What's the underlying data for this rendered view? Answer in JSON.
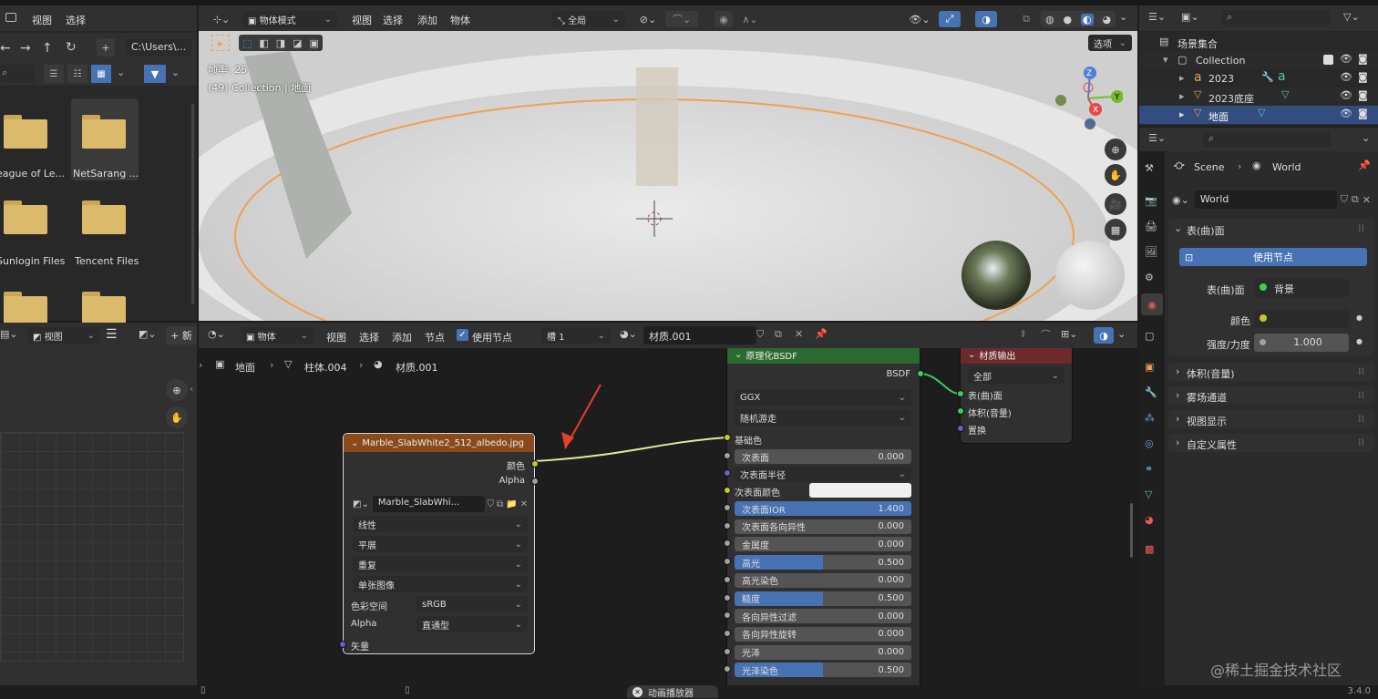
{
  "top_menu": {
    "view": "视图",
    "select": "选择"
  },
  "file_browser": {
    "path": "C:\\Users\\...",
    "folders": [
      "eague of Le...",
      "NetSarang ...",
      "Sunlogin Files",
      "Tencent Files"
    ]
  },
  "viewport": {
    "mode": "物体模式",
    "menus": [
      "视图",
      "选择",
      "添加",
      "物体"
    ],
    "orientation": "全局",
    "options": "选项",
    "frame_rate": "帧率: 25",
    "object_info": "(49) Collection | 地面",
    "gizmo": {
      "x": "X",
      "y": "Y",
      "z": "Z"
    }
  },
  "outliner": {
    "scene_collection": "场景集合",
    "collection": "Collection",
    "items": [
      "2023",
      "2023底座",
      "地面"
    ]
  },
  "properties": {
    "breadcrumb_scene": "Scene",
    "breadcrumb_world": "World",
    "world_name": "World",
    "surface_panel": "表(曲)面",
    "use_nodes_button": "使用节点",
    "surface_label": "表(曲)面",
    "surface_value": "背景",
    "color_label": "颜色",
    "strength_label": "强度/力度",
    "strength_value": "1.000",
    "collapsed_panels": [
      "体积(音量)",
      "雾场通道",
      "视图显示",
      "自定义属性"
    ]
  },
  "image_editor": {
    "view": "视图"
  },
  "node_editor": {
    "type": "物体",
    "menus": [
      "视图",
      "选择",
      "添加",
      "节点"
    ],
    "use_nodes": "使用节点",
    "slot": "槽 1",
    "material": "材质.001",
    "breadcrumb": [
      "地面",
      "柱体.004",
      "材质.001"
    ]
  },
  "image_node": {
    "title": "Marble_SlabWhite2_512_albedo.jpg",
    "out_color": "颜色",
    "out_alpha": "Alpha",
    "image_name": "Marble_SlabWhi...",
    "interpolation": "线性",
    "projection": "平展",
    "extension": "重复",
    "source": "单张图像",
    "colorspace_label": "色彩空间",
    "colorspace": "sRGB",
    "alpha_label": "Alpha",
    "alpha_mode": "直通型",
    "vector": "矢量"
  },
  "bsdf_node": {
    "title": "原理化BSDF",
    "output": "BSDF",
    "distribution": "GGX",
    "subsurface_method": "随机游走",
    "base_color": "基础色",
    "subsurface_color": "次表面颜色",
    "subsurface_radius": "次表面半径",
    "fields": [
      {
        "label": "次表面",
        "value": "0.000",
        "fill": 0
      },
      {
        "label": "次表面IOR",
        "value": "1.400",
        "fill": 1
      },
      {
        "label": "次表面各向异性",
        "value": "0.000",
        "fill": 0
      },
      {
        "label": "金属度",
        "value": "0.000",
        "fill": 0
      },
      {
        "label": "高光",
        "value": "0.500",
        "fill": 0.5
      },
      {
        "label": "高光染色",
        "value": "0.000",
        "fill": 0
      },
      {
        "label": "糙度",
        "value": "0.500",
        "fill": 0.5
      },
      {
        "label": "各向异性过滤",
        "value": "0.000",
        "fill": 0
      },
      {
        "label": "各向异性旋转",
        "value": "0.000",
        "fill": 0
      },
      {
        "label": "光泽",
        "value": "0.000",
        "fill": 0
      },
      {
        "label": "光泽染色",
        "value": "0.500",
        "fill": 0.5
      }
    ]
  },
  "output_node": {
    "title": "材质输出",
    "target": "全部",
    "surface": "表(曲)面",
    "volume": "体积(音量)",
    "displacement": "置换"
  },
  "status": {
    "animation_player": "动画播放器",
    "version": "3.4.0",
    "watermark": "@稀土掘金技术社区"
  },
  "colors": {
    "accent": "#4772b3",
    "header_green": "#2a6a2f",
    "header_orange": "#8a4a1c",
    "header_red": "#6e2a2a",
    "arrow": "#e2402c"
  }
}
